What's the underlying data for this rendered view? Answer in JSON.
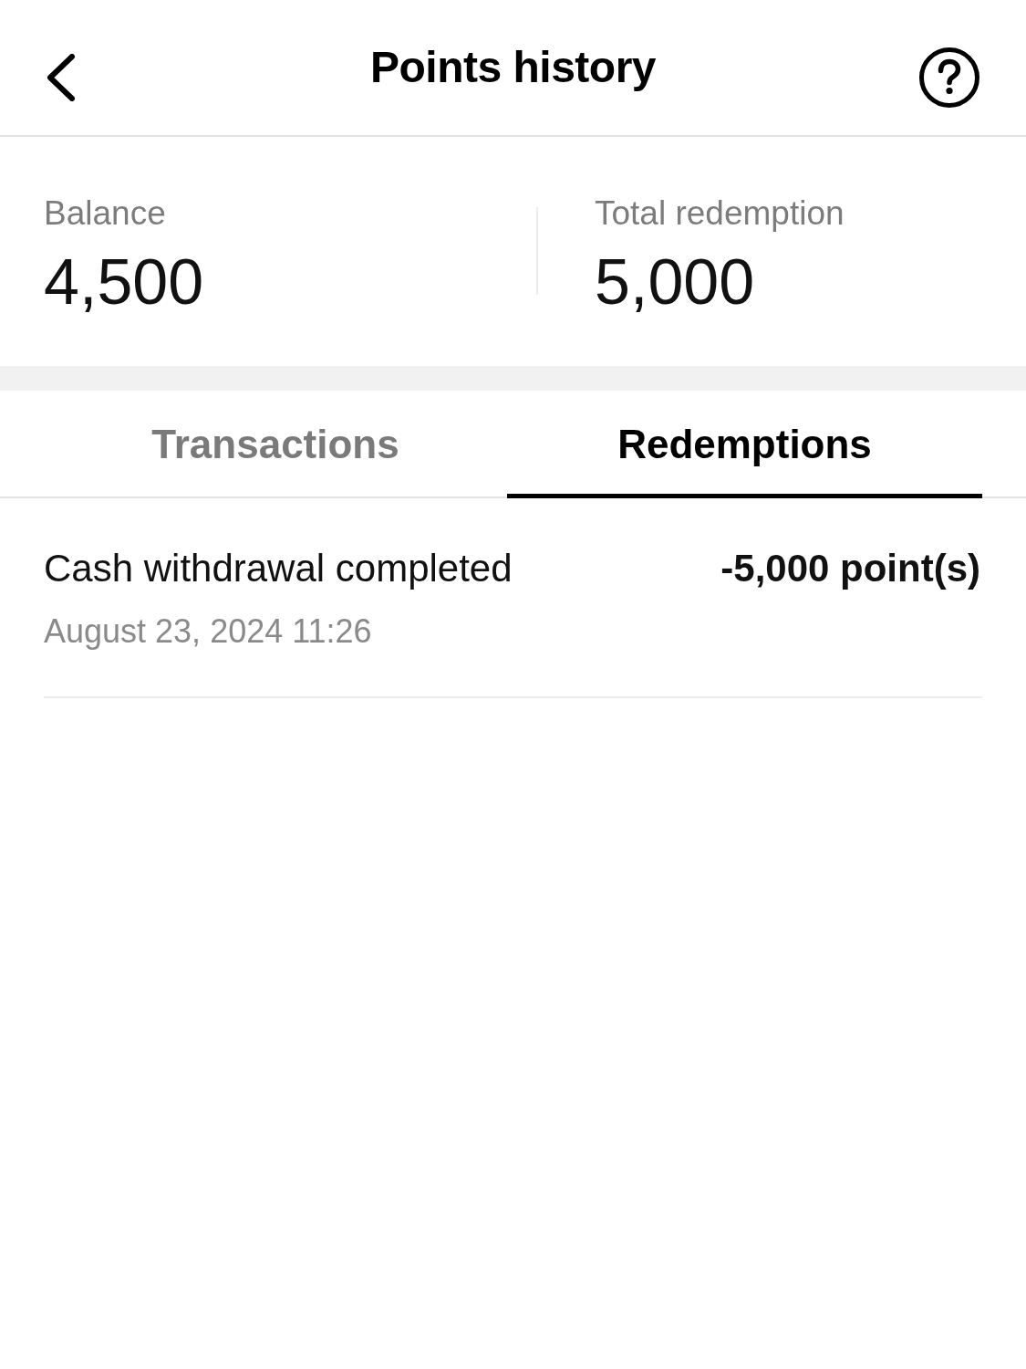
{
  "header": {
    "title": "Points history"
  },
  "summary": [
    {
      "label": "Balance",
      "value": "4,500"
    },
    {
      "label": "Total redemption",
      "value": "5,000"
    }
  ],
  "tabs": [
    {
      "label": "Transactions",
      "selected": false
    },
    {
      "label": "Redemptions",
      "selected": true
    }
  ],
  "entries": [
    {
      "title": "Cash withdrawal completed",
      "date": "August 23, 2024 11:26",
      "amount": "-5,000 point(s)"
    }
  ]
}
